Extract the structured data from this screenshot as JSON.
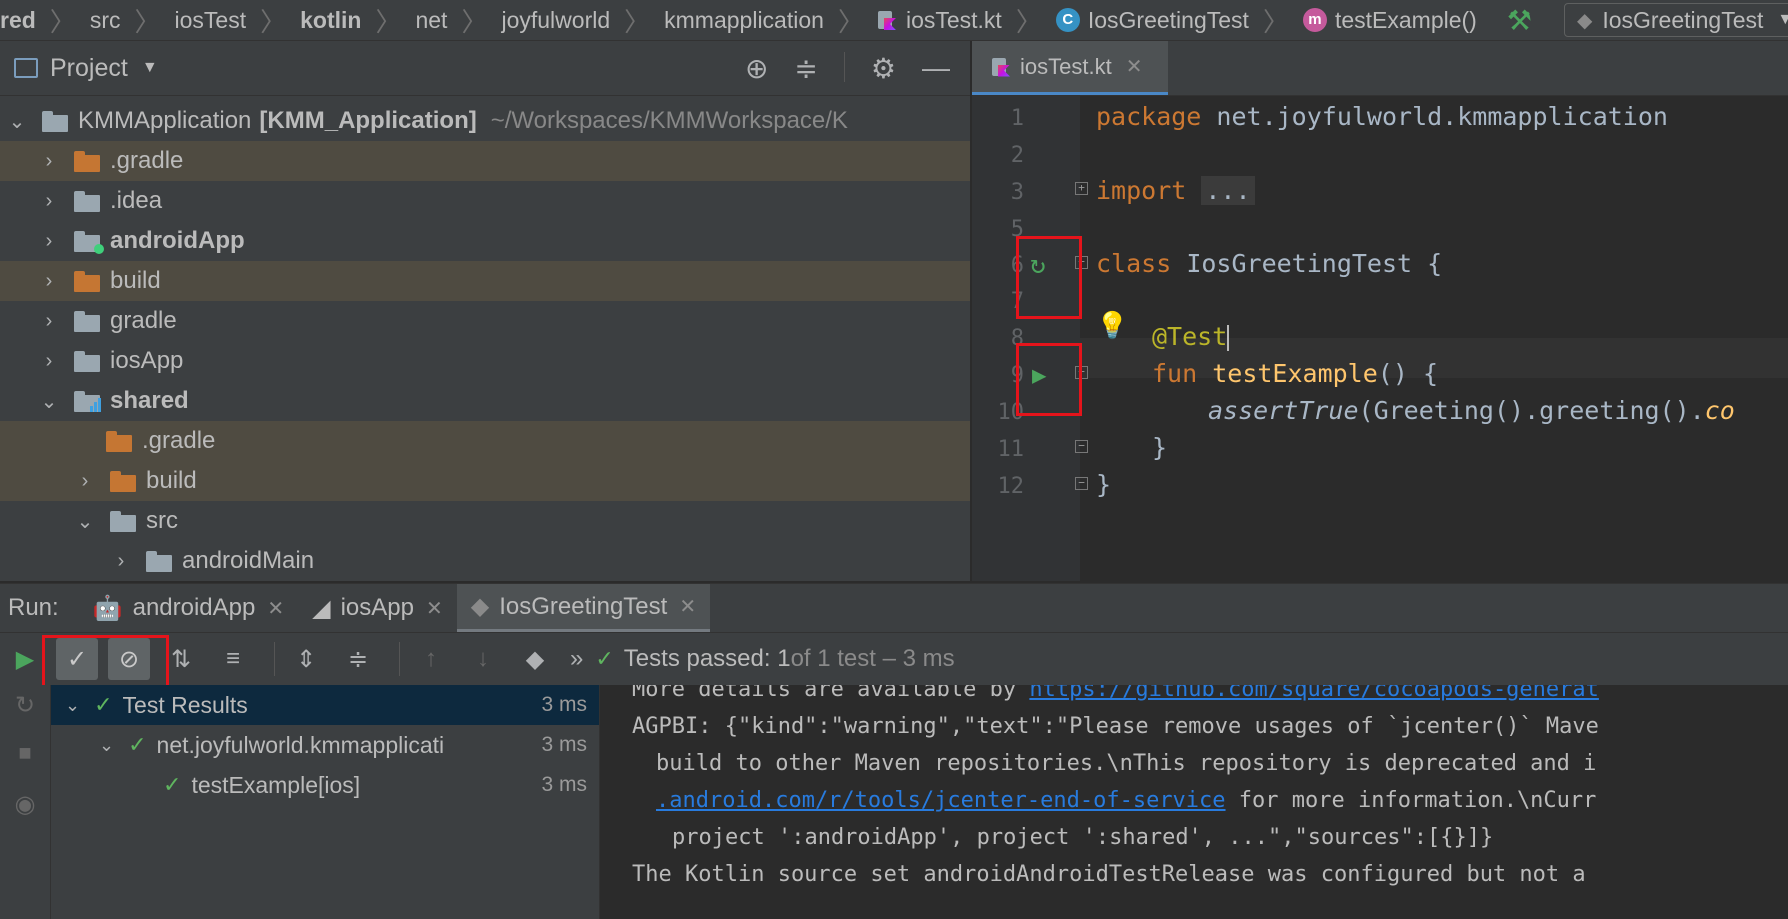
{
  "breadcrumb": {
    "items": [
      "red",
      "src",
      "iosTest",
      "kotlin",
      "net",
      "joyfulworld",
      "kmmapplication"
    ],
    "file": "iosTest.kt",
    "class": "IosGreetingTest",
    "method": "testExample()",
    "run_config": "IosGreetingTest"
  },
  "project": {
    "title": "Project",
    "root": {
      "name": "KMMApplication",
      "module": "[KMM_Application]",
      "path": "~/Workspaces/KMMWorkspace/K"
    },
    "items": [
      {
        "label": ".gradle"
      },
      {
        "label": ".idea"
      },
      {
        "label": "androidApp"
      },
      {
        "label": "build"
      },
      {
        "label": "gradle"
      },
      {
        "label": "iosApp"
      },
      {
        "label": "shared"
      },
      {
        "label": ".gradle"
      },
      {
        "label": "build"
      },
      {
        "label": "src"
      },
      {
        "label": "androidMain"
      }
    ]
  },
  "editor": {
    "tab": "iosTest.kt",
    "line_numbers": [
      "1",
      "2",
      "3",
      "5",
      "6",
      "7",
      "8",
      "9",
      "10",
      "11",
      "12"
    ],
    "code": {
      "l1_kw": "package",
      "l1_rest": " net.joyfulworld.kmmapplication",
      "l3_kw": "import",
      "l3_fold": "...",
      "l6_kw": "class",
      "l6_rest": " IosGreetingTest {",
      "l8_ann": "@Test",
      "l9_kw": "fun",
      "l9_fn": "testExample",
      "l9_rest": "() {",
      "l10_it": "assertTrue",
      "l10_rest": "(Greeting().greeting().",
      "l10_tail": "co",
      "l11": "}",
      "l12": "}"
    }
  },
  "run": {
    "label": "Run:",
    "tabs": [
      "androidApp",
      "iosApp",
      "IosGreetingTest"
    ],
    "status": {
      "main": "Tests passed: 1",
      "rest": " of 1 test – 3 ms"
    },
    "results": [
      {
        "label": "Test Results",
        "time": "3 ms"
      },
      {
        "label": "net.joyfulworld.kmmapplicati",
        "time": "3 ms"
      },
      {
        "label": "testExample[ios]",
        "time": "3 ms"
      }
    ],
    "console": {
      "l1_a": "More details are available by ",
      "l1_link": "https://github.com/square/cocoapods-generat",
      "l2": "AGPBI: {\"kind\":\"warning\",\"text\":\"Please remove usages of `jcenter()` Mave",
      "l3": "build to other Maven repositories.\\nThis repository is deprecated and i",
      "l4_link": ".android.com/r/tools/jcenter-end-of-service",
      "l4_rest": " for more information.\\nCurr",
      "l5": "project ':androidApp', project ':shared', ...\",\"sources\":[{}]}",
      "l6": "The Kotlin source set androidAndroidTestRelease was configured but not a"
    }
  }
}
